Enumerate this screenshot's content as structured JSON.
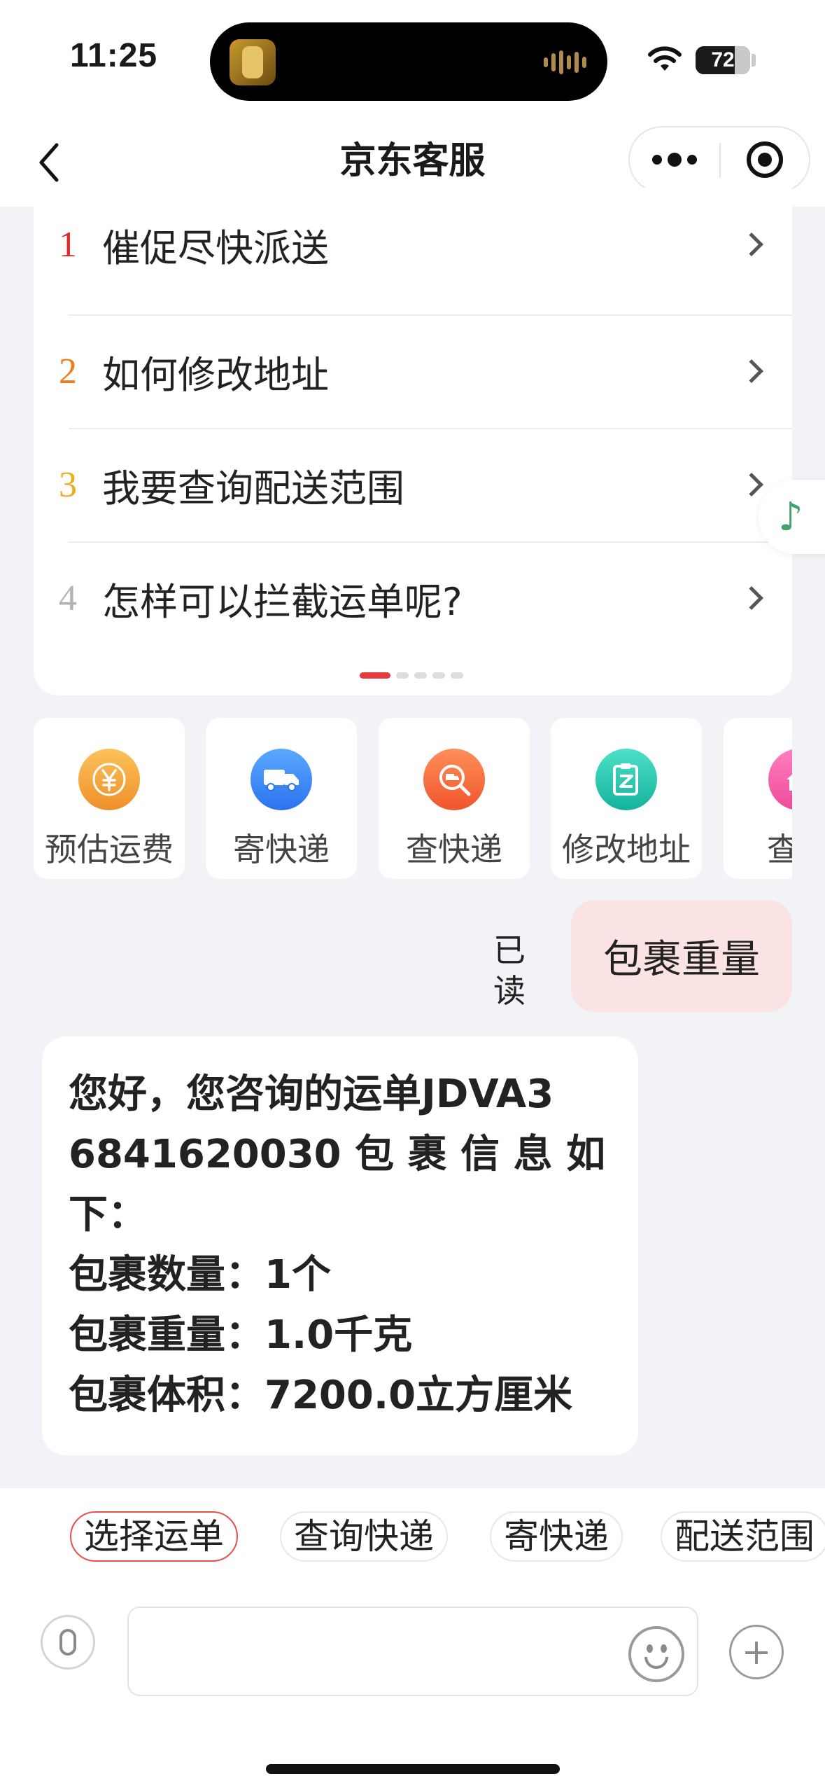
{
  "status_bar": {
    "time": "11:25",
    "battery": "72",
    "battery_level": 0.72,
    "icons": [
      "app-avatar-icon",
      "audio-wave-icon",
      "wifi-icon",
      "battery-icon"
    ]
  },
  "nav": {
    "title": "京东客服",
    "icons": [
      "back-icon",
      "more-icon",
      "target-icon"
    ]
  },
  "faq": {
    "items": [
      {
        "num": "1",
        "label": "催促尽快派送",
        "color": "#e02a2a"
      },
      {
        "num": "2",
        "label": "如何修改地址",
        "color": "#f07b1b"
      },
      {
        "num": "3",
        "label": "我要查询配送范围",
        "color": "#e8b01f"
      },
      {
        "num": "4",
        "label": "怎样可以拦截运单呢?",
        "color": "#b3b3b3"
      }
    ],
    "page_count": 5,
    "active_page": 1
  },
  "services": [
    {
      "label": "预估运费",
      "icon": "yen-icon",
      "color": "#f5a53c"
    },
    {
      "label": "寄快递",
      "icon": "truck-icon",
      "color": "#3f8ff5"
    },
    {
      "label": "查快递",
      "icon": "search-truck-icon",
      "color": "#f56a3a"
    },
    {
      "label": "修改地址",
      "icon": "edit-doc-icon",
      "color": "#22c6b0"
    },
    {
      "label": "查询",
      "icon": "home-icon",
      "color": "#f25aa8"
    }
  ],
  "chat": {
    "read_status": "已读",
    "user_message": "包裹重量",
    "bot_lines": [
      "您好，您咨询的运单JDVA3",
      "6841620030 包 裹 信 息 如",
      "下：",
      "包裹数量：1个",
      "包裹重量：1.0千克",
      "包裹体积：7200.0立方厘米"
    ]
  },
  "chips": [
    "选择运单",
    "查询快递",
    "寄快递",
    "配送范围"
  ],
  "input": {
    "value": "",
    "icons": [
      "voice-icon",
      "emoji-icon",
      "plus-icon"
    ]
  },
  "colors": {
    "accent": "#e43b3f",
    "user_bubble": "#fbe3e3",
    "background": "#f2f3f7"
  }
}
